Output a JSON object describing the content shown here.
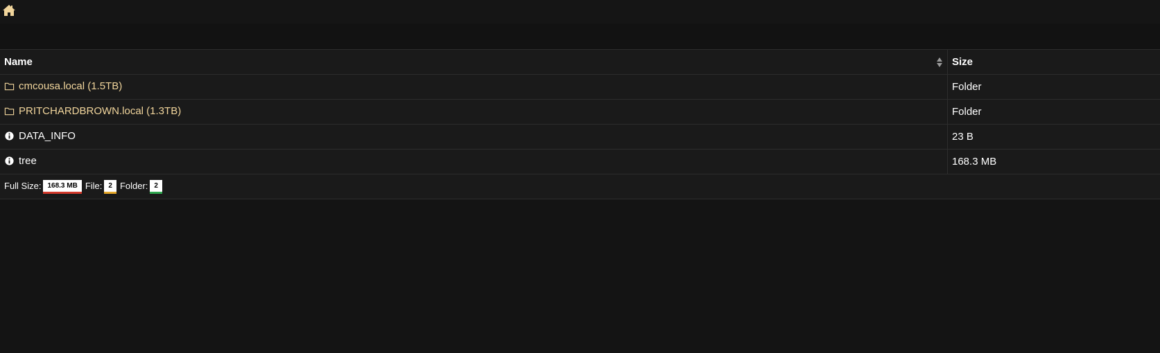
{
  "nav": {
    "home_icon": "home-icon"
  },
  "table": {
    "headers": {
      "name": "Name",
      "size": "Size"
    },
    "rows": [
      {
        "icon": "folder-icon",
        "name": "cmcousa.local (1.5TB)",
        "size": "Folder",
        "type": "folder"
      },
      {
        "icon": "folder-icon",
        "name": "PRITCHARDBROWN.local (1.3TB)",
        "size": "Folder",
        "type": "folder"
      },
      {
        "icon": "info-icon",
        "name": "DATA_INFO",
        "size": "23 B",
        "type": "file"
      },
      {
        "icon": "info-icon",
        "name": "tree",
        "size": "168.3 MB",
        "type": "file"
      }
    ]
  },
  "footer": {
    "full_size_label": "Full Size:",
    "full_size_value": "168.3 MB",
    "file_label": "File:",
    "file_value": "2",
    "folder_label": "Folder:",
    "folder_value": "2"
  },
  "colors": {
    "background": "#141414",
    "folder_text": "#f1d59c",
    "size_accent": "#d33a2c",
    "file_accent": "#e6a82a",
    "folder_accent": "#2fa84f"
  }
}
